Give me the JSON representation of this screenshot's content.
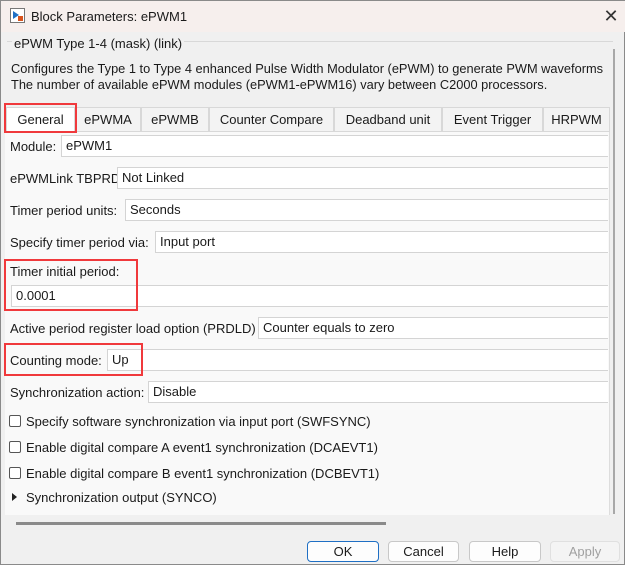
{
  "window": {
    "title": "Block Parameters: ePWM1",
    "close_icon": "close-icon"
  },
  "mask": {
    "title": "ePWM Type 1-4 (mask) (link)",
    "description_line1": "Configures the Type 1 to Type 4 enhanced Pulse Width Modulator (ePWM) to generate PWM waveforms",
    "description_line2": "The number of available ePWM modules (ePWM1-ePWM16) vary between C2000 processors."
  },
  "tabs": [
    {
      "label": "General"
    },
    {
      "label": "ePWMA"
    },
    {
      "label": "ePWMB"
    },
    {
      "label": "Counter Compare"
    },
    {
      "label": "Deadband unit"
    },
    {
      "label": "Event Trigger"
    },
    {
      "label": "HRPWM"
    }
  ],
  "params": {
    "module": {
      "label": "Module:",
      "value": "ePWM1"
    },
    "link": {
      "label": "ePWMLink TBPRD",
      "value": "Not Linked"
    },
    "units": {
      "label": "Timer period units:",
      "value": "Seconds"
    },
    "via": {
      "label": "Specify timer period via:",
      "value": "Input port"
    },
    "initial": {
      "label": "Timer initial period:",
      "value": "0.0001"
    },
    "prdld": {
      "label": "Active period register load option (PRDLD)",
      "value": "Counter equals to zero"
    },
    "counting": {
      "label": "Counting mode:",
      "value": "Up"
    },
    "sync": {
      "label": "Synchronization action:",
      "value": "Disable"
    }
  },
  "checkboxes": [
    {
      "label": "Specify software synchronization via input port (SWFSYNC)",
      "checked": false
    },
    {
      "label": "Enable digital compare A event1 synchronization (DCAEVT1)",
      "checked": false
    },
    {
      "label": "Enable digital compare B event1 synchronization (DCBEVT1)",
      "checked": false
    }
  ],
  "section": {
    "label": "Synchronization output (SYNCO)"
  },
  "buttons": {
    "ok": "OK",
    "cancel": "Cancel",
    "help": "Help",
    "apply": "Apply"
  }
}
